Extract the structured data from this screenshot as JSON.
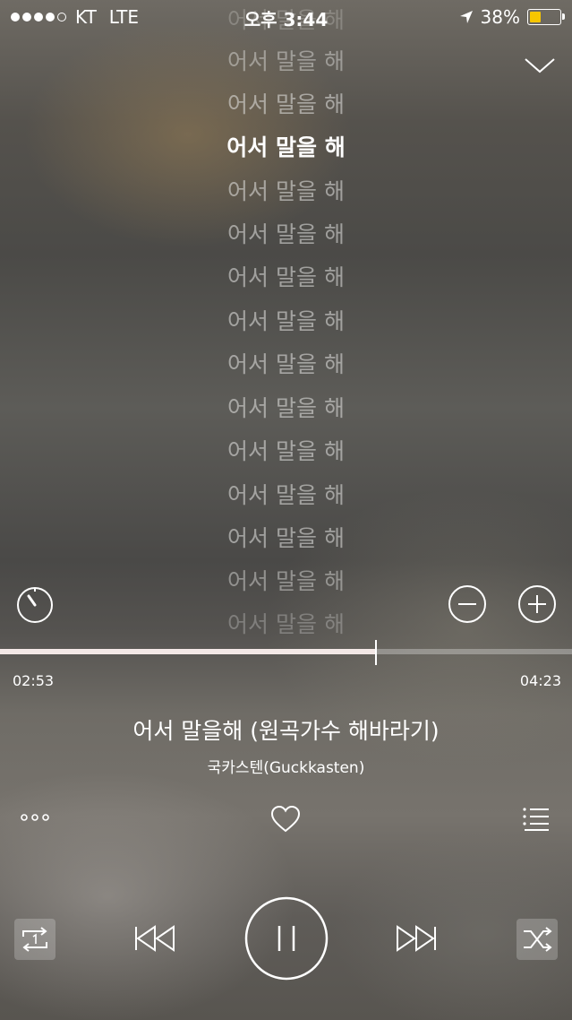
{
  "status_bar": {
    "carrier": "KT",
    "network": "LTE",
    "time": "오후 3:44",
    "battery": "38%",
    "battery_level": 0.38
  },
  "lyrics": {
    "top_partial": "어서 말을 해",
    "lines": [
      "어서 말을 해",
      "어서 말을 해",
      "어서 말을 해",
      "어서 말을 해",
      "어서 말을 해",
      "어서 말을 해",
      "어서 말을 해",
      "어서 말을 해",
      "어서 말을 해",
      "어서 말을 해",
      "어서 말을 해",
      "어서 말을 해",
      "어서 말을 해",
      "어서 말을 해"
    ]
  },
  "playback": {
    "elapsed": "02:53",
    "total": "04:23",
    "progress": 0.657
  },
  "track": {
    "title": "어서 말을해 (원곡가수 해바라기)",
    "artist": "국카스텐(Guckkasten)"
  },
  "colors": {
    "battery_fill": "#f7c600",
    "progress_fill": "#f3e8e6"
  }
}
